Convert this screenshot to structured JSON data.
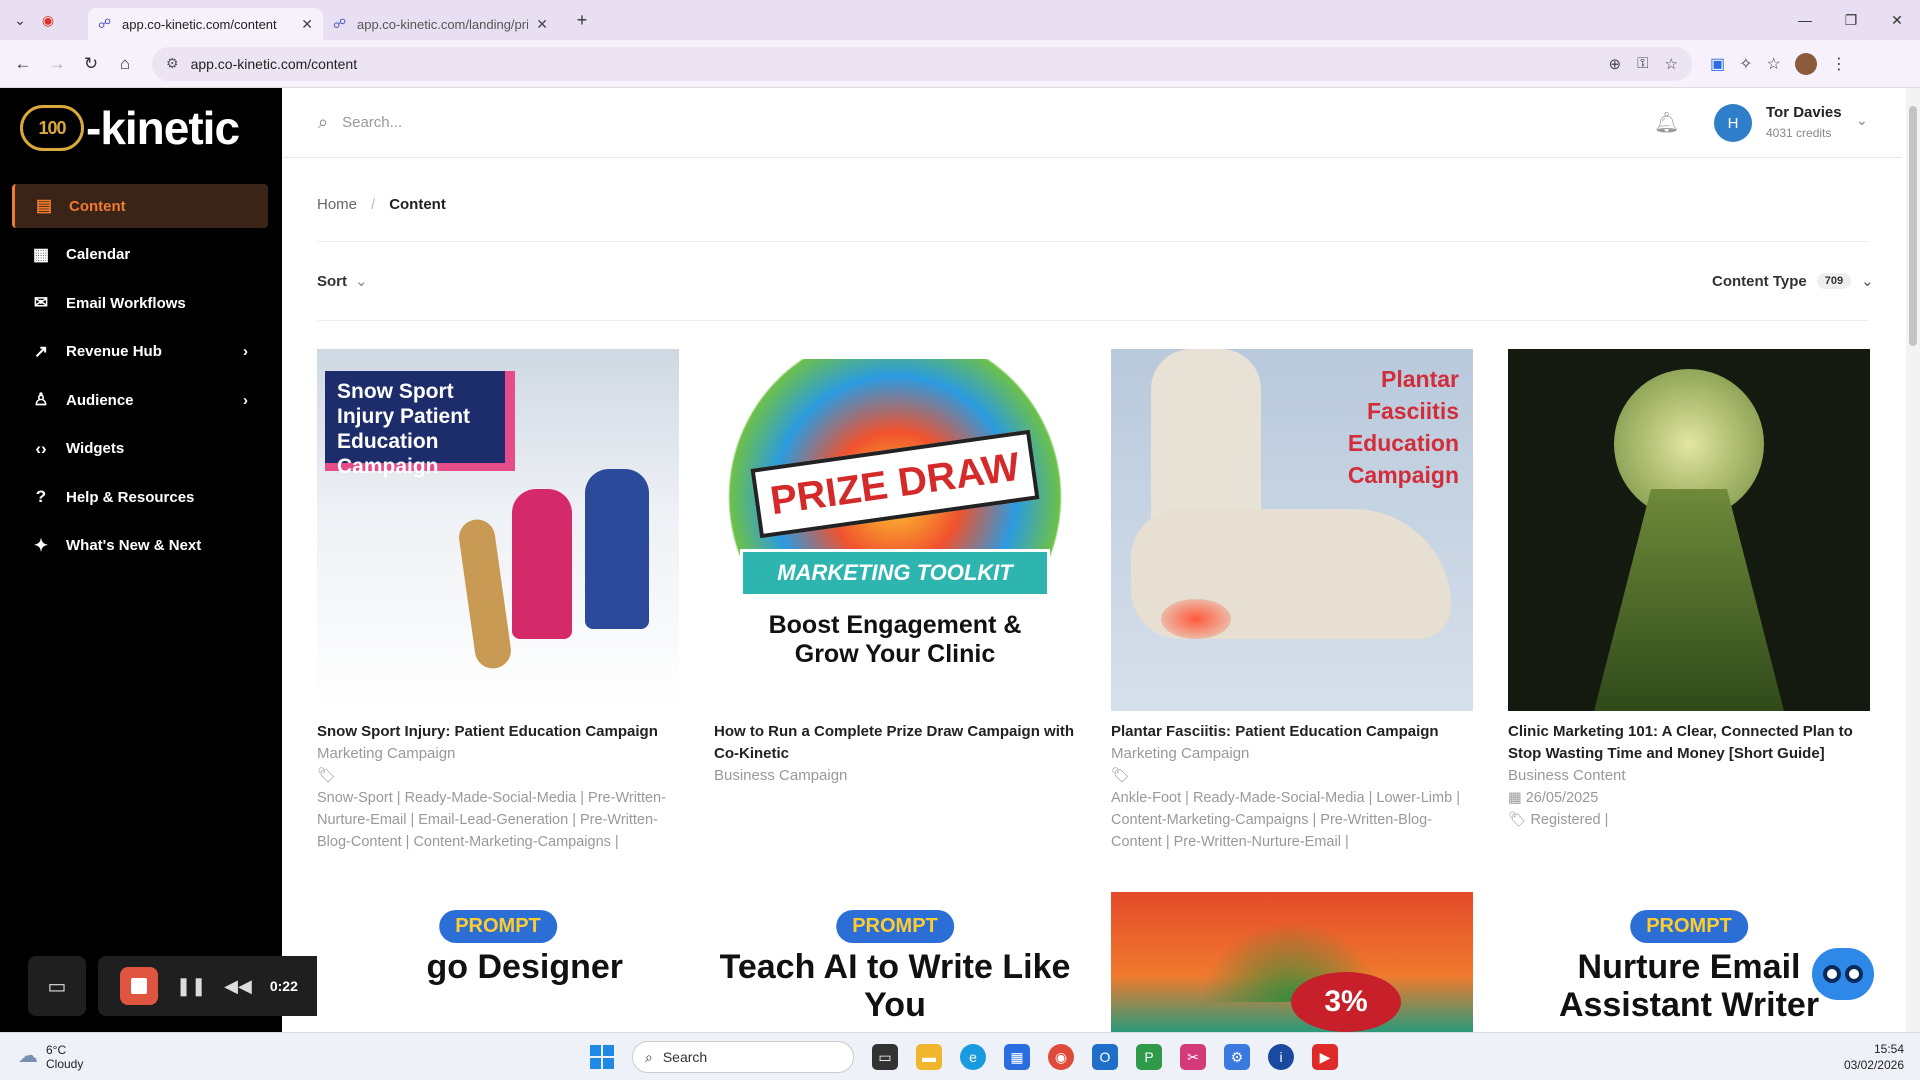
{
  "browser": {
    "tabs": [
      {
        "title": "app.co-kinetic.com/content",
        "active": true
      },
      {
        "title": "app.co-kinetic.com/landing/pri",
        "active": false
      }
    ],
    "url": "app.co-kinetic.com/content"
  },
  "app": {
    "logo_text": "-kinetic",
    "logo_badge": "100"
  },
  "sidebar": {
    "items": [
      {
        "label": "Content",
        "icon": "document-icon",
        "glyph": "▤",
        "active": true
      },
      {
        "label": "Calendar",
        "icon": "calendar-icon",
        "glyph": "▦",
        "active": false
      },
      {
        "label": "Email Workflows",
        "icon": "mail-icon",
        "glyph": "✉",
        "active": false
      },
      {
        "label": "Revenue Hub",
        "icon": "trend-icon",
        "glyph": "↗",
        "active": false,
        "chevron": "›"
      },
      {
        "label": "Audience",
        "icon": "users-icon",
        "glyph": "♙",
        "active": false,
        "chevron": "›"
      },
      {
        "label": "Widgets",
        "icon": "code-icon",
        "glyph": "‹›",
        "active": false
      },
      {
        "label": "Help & Resources",
        "icon": "help-icon",
        "glyph": "?",
        "active": false
      },
      {
        "label": "What's New & Next",
        "icon": "sparkle-icon",
        "glyph": "✦",
        "active": false
      }
    ]
  },
  "recorder": {
    "time": "0:22"
  },
  "topbar": {
    "search_placeholder": "Search...",
    "user_initial": "H",
    "user_name": "Tor Davies",
    "user_credits": "4031 credits"
  },
  "breadcrumb": {
    "home": "Home",
    "sep": "/",
    "current": "Content"
  },
  "toolbar": {
    "sort_label": "Sort",
    "content_type_label": "Content Type",
    "content_type_count": "709"
  },
  "cards": [
    {
      "thumb_text": "Snow Sport Injury Patient Education Campaign",
      "title": "Snow Sport Injury: Patient Education Campaign",
      "type": "Marketing Campaign",
      "tags": "Snow-Sport | Ready-Made-Social-Media | Pre-Written-Nurture-Email | Email-Lead-Generation | Pre-Written-Blog-Content | Content-Marketing-Campaigns |"
    },
    {
      "thumb_text_1": "PRIZE DRAW",
      "thumb_text_2": "MARKETING TOOLKIT",
      "thumb_text_3": "Boost Engagement & Grow Your Clinic",
      "title": "How to Run a Complete Prize Draw Campaign with Co-Kinetic",
      "type": "Business Campaign"
    },
    {
      "thumb_text": "Plantar Fasciitis Education Campaign",
      "title": "Plantar Fasciitis: Patient Education Campaign",
      "type": "Marketing Campaign",
      "tags": "Ankle-Foot | Ready-Made-Social-Media | Lower-Limb | Content-Marketing-Campaigns | Pre-Written-Blog-Content | Pre-Written-Nurture-Email |"
    },
    {
      "title": "Clinic Marketing 101: A Clear, Connected Plan to Stop Wasting Time and Money [Short Guide]",
      "type": "Business Content",
      "date": "26/05/2025",
      "tags": "Registered |"
    }
  ],
  "row2": [
    {
      "pill": "PROMPT",
      "text": "go Designer"
    },
    {
      "pill": "PROMPT",
      "text": "Teach AI to Write Like You"
    },
    {
      "badge": "3%"
    },
    {
      "pill": "PROMPT",
      "text": "Nurture Email Assistant Writer"
    }
  ],
  "taskbar": {
    "temp": "6°C",
    "weather": "Cloudy",
    "search": "Search",
    "time": "15:54",
    "date": "03/02/2026"
  },
  "colors": {
    "accent": "#f07a2e",
    "sidebar_bg": "#000000",
    "avatar": "#2f7ec9"
  }
}
